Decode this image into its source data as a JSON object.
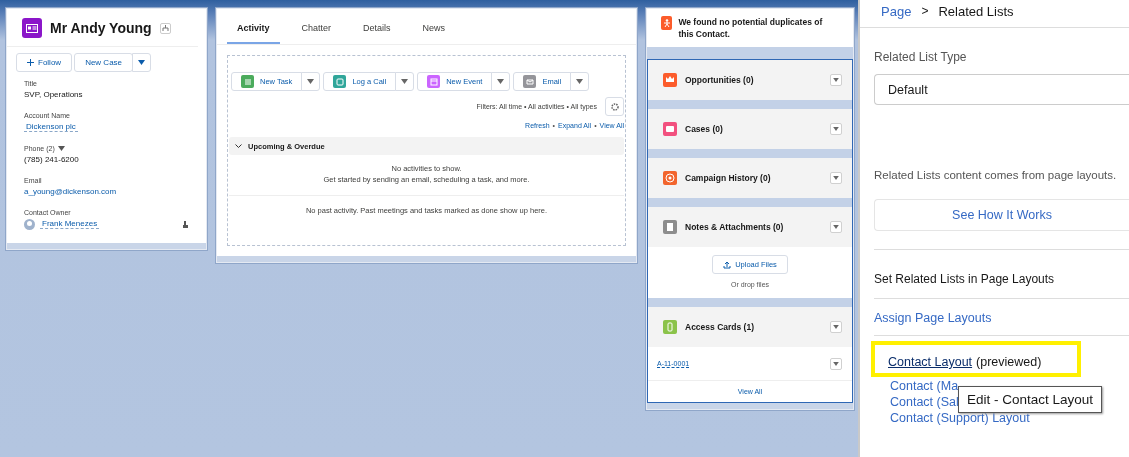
{
  "contact_card": {
    "name": "Mr Andy Young",
    "buttons": [
      {
        "label": "Follow",
        "kind": "follow"
      },
      {
        "label": "New Case",
        "kind": "plain"
      }
    ],
    "fields": [
      {
        "label": "Title",
        "value": "SVP, Operations",
        "kind": "text"
      },
      {
        "label": "Account Name",
        "value": "Dickenson plc",
        "kind": "link"
      },
      {
        "label": "Phone (2)",
        "value": "(785) 241-6200",
        "kind": "phone"
      },
      {
        "label": "Email",
        "value": "a_young@dickenson.com",
        "kind": "email"
      },
      {
        "label": "Contact Owner",
        "value": "Frank Menezes",
        "kind": "owner"
      }
    ]
  },
  "activity_card": {
    "tabs": [
      {
        "label": "Activity",
        "selected": true
      },
      {
        "label": "Chatter",
        "selected": false
      },
      {
        "label": "Details",
        "selected": false
      },
      {
        "label": "News",
        "selected": false
      }
    ],
    "actions": [
      {
        "label": "New Task",
        "color": "#4bab5c",
        "kind": "task"
      },
      {
        "label": "Log a Call",
        "color": "#30a69a",
        "kind": "call"
      },
      {
        "label": "New Event",
        "color": "#cb65ff",
        "kind": "event"
      },
      {
        "label": "Email",
        "color": "#95959a",
        "kind": "email"
      }
    ],
    "filters": "Filters: All time • All activities • All types",
    "links": [
      "Refresh",
      "Expand All",
      "View All"
    ],
    "link_separator": "•",
    "section": {
      "title": "Upcoming & Overdue",
      "expanded": true,
      "empty_title": "No activities to show.",
      "empty_text": "Get started by sending an email, scheduling a task, and more."
    },
    "past_text": "No past activity. Past meetings and tasks marked as done show up here."
  },
  "related_card": {
    "notice": "We found no potential duplicates of this Contact.",
    "lists": [
      {
        "title": "Opportunities (0)",
        "color": "#fc5c2b",
        "kind": "crown"
      },
      {
        "title": "Cases (0)",
        "color": "#f2517f",
        "kind": "case"
      },
      {
        "title": "Campaign History (0)",
        "color": "#f2652d",
        "kind": "target"
      },
      {
        "title": "Notes & Attachments (0)",
        "color": "#8d8d8d",
        "kind": "files",
        "upload_label": "Upload Files",
        "drop_text": "Or drop files"
      },
      {
        "title": "Access Cards (1)",
        "color": "#8bc34a",
        "kind": "records",
        "records": [
          "A-11-0001"
        ],
        "footer": "View All"
      }
    ]
  },
  "properties_panel": {
    "breadcrumb": [
      "Page",
      "Related Lists"
    ],
    "breadcrumb_separator": ">",
    "type_label": "Related List Type",
    "type_value": "Default",
    "info": "Related Lists content comes from page layouts.",
    "how_button": "See How It Works",
    "section_label": "Set Related Lists in Page Layouts",
    "assign_link": "Assign Page Layouts",
    "layouts": [
      {
        "name": "Contact Layout",
        "note": "(previewed)",
        "highlighted": true
      },
      {
        "name": "Contact (Ma",
        "highlighted": false
      },
      {
        "name": "Contact (Sal",
        "highlighted": false
      },
      {
        "name": "Contact (Support) Layout",
        "highlighted": false
      }
    ],
    "tooltip": "Edit -  Contact Layout"
  }
}
